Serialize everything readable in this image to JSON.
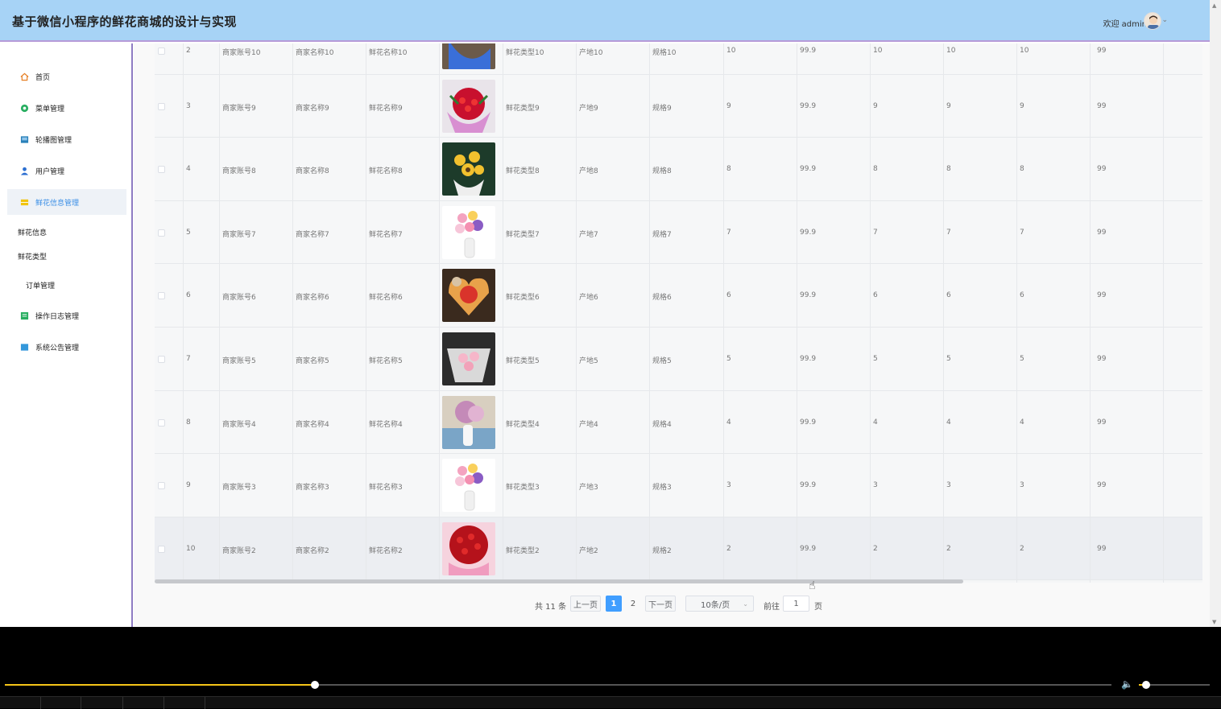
{
  "header": {
    "title": "基于微信小程序的鲜花商城的设计与实现",
    "welcome": "欢迎 admin"
  },
  "sidebar": {
    "items": [
      {
        "label": "首页",
        "icon": "home-icon",
        "color": "#e67e22"
      },
      {
        "label": "菜单管理",
        "icon": "menu-icon",
        "color": "#27ae60"
      },
      {
        "label": "轮播图管理",
        "icon": "carousel-icon",
        "color": "#2980b9"
      },
      {
        "label": "用户管理",
        "icon": "user-icon",
        "color": "#2c6fd1"
      },
      {
        "label": "鲜花信息管理",
        "icon": "flower-icon",
        "color": "#f1c40f"
      }
    ],
    "submenu": [
      "鲜花信息",
      "鲜花类型"
    ],
    "items2": [
      {
        "label": "订单管理",
        "icon": "",
        "color": ""
      },
      {
        "label": "操作日志管理",
        "icon": "log-icon",
        "color": "#27ae60"
      },
      {
        "label": "系统公告管理",
        "icon": "notice-icon",
        "color": "#3498db"
      }
    ]
  },
  "table": {
    "rows": [
      {
        "idx": "2",
        "acct": "商家账号10",
        "name": "商家名称10",
        "flower": "鲜花名称10",
        "type": "鲜花类型10",
        "origin": "产地10",
        "spec": "规格10",
        "c1": "10",
        "price": "99.9",
        "c2": "10",
        "c3": "10",
        "c4": "10",
        "c5": "99",
        "img": "blue-bouquet"
      },
      {
        "idx": "3",
        "acct": "商家账号9",
        "name": "商家名称9",
        "flower": "鲜花名称9",
        "type": "鲜花类型9",
        "origin": "产地9",
        "spec": "规格9",
        "c1": "9",
        "price": "99.9",
        "c2": "9",
        "c3": "9",
        "c4": "9",
        "c5": "99",
        "img": "red-roses-pink"
      },
      {
        "idx": "4",
        "acct": "商家账号8",
        "name": "商家名称8",
        "flower": "鲜花名称8",
        "type": "鲜花类型8",
        "origin": "产地8",
        "spec": "规格8",
        "c1": "8",
        "price": "99.9",
        "c2": "8",
        "c3": "8",
        "c4": "8",
        "c5": "99",
        "img": "sunflowers"
      },
      {
        "idx": "5",
        "acct": "商家账号7",
        "name": "商家名称7",
        "flower": "鲜花名称7",
        "type": "鲜花类型7",
        "origin": "产地7",
        "spec": "规格7",
        "c1": "7",
        "price": "99.9",
        "c2": "7",
        "c3": "7",
        "c4": "7",
        "c5": "99",
        "img": "vase-mixed"
      },
      {
        "idx": "6",
        "acct": "商家账号6",
        "name": "商家名称6",
        "flower": "鲜花名称6",
        "type": "鲜花类型6",
        "origin": "产地6",
        "spec": "规格6",
        "c1": "6",
        "price": "99.9",
        "c2": "6",
        "c3": "6",
        "c4": "6",
        "c5": "99",
        "img": "heart-box"
      },
      {
        "idx": "7",
        "acct": "商家账号5",
        "name": "商家名称5",
        "flower": "鲜花名称5",
        "type": "鲜花类型5",
        "origin": "产地5",
        "spec": "规格5",
        "c1": "5",
        "price": "99.9",
        "c2": "5",
        "c3": "5",
        "c4": "5",
        "c5": "99",
        "img": "pink-wrap"
      },
      {
        "idx": "8",
        "acct": "商家账号4",
        "name": "商家名称4",
        "flower": "鲜花名称4",
        "type": "鲜花类型4",
        "origin": "产地4",
        "spec": "规格4",
        "c1": "4",
        "price": "99.9",
        "c2": "4",
        "c3": "4",
        "c4": "4",
        "c5": "99",
        "img": "lilac-vase"
      },
      {
        "idx": "9",
        "acct": "商家账号3",
        "name": "商家名称3",
        "flower": "鲜花名称3",
        "type": "鲜花类型3",
        "origin": "产地3",
        "spec": "规格3",
        "c1": "3",
        "price": "99.9",
        "c2": "3",
        "c3": "3",
        "c4": "3",
        "c5": "99",
        "img": "vase-mixed"
      },
      {
        "idx": "10",
        "acct": "商家账号2",
        "name": "商家名称2",
        "flower": "鲜花名称2",
        "type": "鲜花类型2",
        "origin": "产地2",
        "spec": "规格2",
        "c1": "2",
        "price": "99.9",
        "c2": "2",
        "c3": "2",
        "c4": "2",
        "c5": "99",
        "img": "big-red-roses"
      }
    ]
  },
  "pager": {
    "total": "共 11 条",
    "prev": "上一页",
    "pages": [
      "1",
      "2"
    ],
    "current": "1",
    "next": "下一页",
    "size": "10条/页",
    "goto": "前往",
    "goto_value": "1",
    "page_unit": "页"
  },
  "player": {
    "progress": 0.28,
    "volume": 0.1
  }
}
